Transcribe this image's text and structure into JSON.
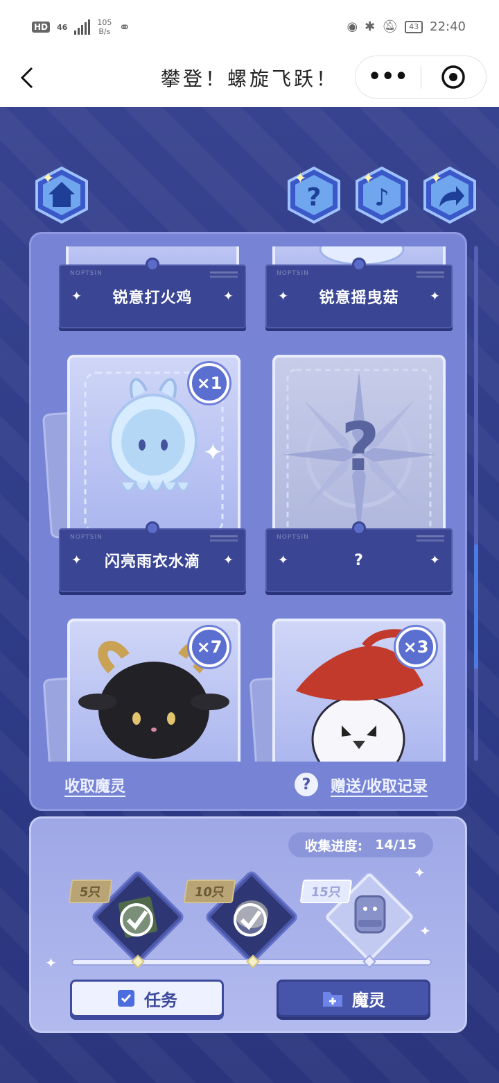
{
  "status": {
    "hd": "HD",
    "network": "46",
    "speed_value": "105",
    "speed_unit": "B/s",
    "battery": "43",
    "time": "22:40"
  },
  "nav": {
    "title": "攀登！螺旋飞跃！",
    "more_label": "•••"
  },
  "cards": [
    {
      "name": "锐意打火鸡",
      "count": "",
      "state": "owned"
    },
    {
      "name": "锐意摇曳菇",
      "count": "",
      "state": "owned"
    },
    {
      "name": "闪亮雨衣水滴",
      "count": "×1",
      "state": "owned"
    },
    {
      "name": "?",
      "count": "",
      "state": "unknown"
    },
    {
      "name": "",
      "count": "×7",
      "state": "owned"
    },
    {
      "name": "",
      "count": "×3",
      "state": "owned"
    }
  ],
  "unknown_mark": "?",
  "links": {
    "collect": "收取魔灵",
    "help": "?",
    "records": "赠送/收取记录"
  },
  "progress": {
    "label": "收集进度:",
    "value": "14/15",
    "collected": 14,
    "total": 15
  },
  "milestones": [
    {
      "label": "5只",
      "state": "done"
    },
    {
      "label": "10只",
      "state": "done"
    },
    {
      "label": "15只",
      "state": "todo"
    }
  ],
  "buttons": {
    "tasks": "任务",
    "spirits": "魔灵"
  },
  "colors": {
    "background": "#2d377f",
    "panel": "#7784d6",
    "plate": "#3a4694",
    "accent": "#5b6fd0"
  },
  "icons": [
    "home-icon",
    "help-icon",
    "music-icon",
    "share-icon"
  ]
}
